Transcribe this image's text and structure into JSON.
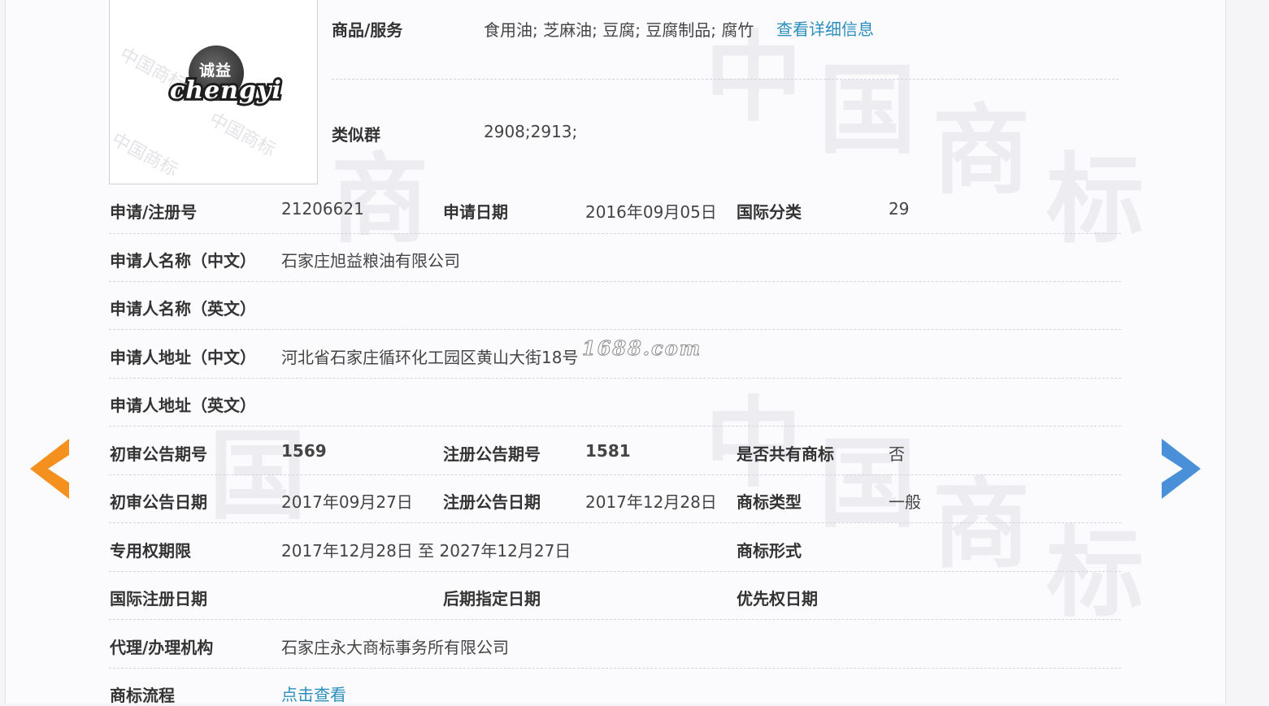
{
  "colors": {
    "label": "#333333",
    "value": "#444444",
    "link": "#2a8fbd",
    "prev_arrow": "#f4901e",
    "next_arrow": "#4a90d9"
  },
  "logo": {
    "brand_cn": "诚益",
    "brand_en": "chengyi",
    "watermark_text": "中国商标"
  },
  "background_watermark": [
    "中",
    "国",
    "商",
    "标"
  ],
  "site_watermark": "1688.com",
  "goods": {
    "label": "商品/服务",
    "value": "食用油; 芝麻油; 豆腐; 豆腐制品; 腐竹",
    "link": "查看详细信息"
  },
  "similar_group": {
    "label": "类似群",
    "value": "2908;2913;"
  },
  "fields": {
    "reg_no": {
      "label": "申请/注册号",
      "value": "21206621"
    },
    "apply_date": {
      "label": "申请日期",
      "value": "2016年09月05日"
    },
    "intl_class": {
      "label": "国际分类",
      "value": "29"
    },
    "applicant_cn": {
      "label": "申请人名称（中文）",
      "value": "石家庄旭益粮油有限公司"
    },
    "applicant_en": {
      "label": "申请人名称（英文）",
      "value": ""
    },
    "address_cn": {
      "label": "申请人地址（中文）",
      "value": "河北省石家庄循环化工园区黄山大街18号"
    },
    "address_en": {
      "label": "申请人地址（英文）",
      "value": ""
    },
    "prelim_issue": {
      "label": "初审公告期号",
      "value": "1569"
    },
    "reg_issue": {
      "label": "注册公告期号",
      "value": "1581"
    },
    "shared": {
      "label": "是否共有商标",
      "value": "否"
    },
    "prelim_date": {
      "label": "初审公告日期",
      "value": "2017年09月27日"
    },
    "reg_date": {
      "label": "注册公告日期",
      "value": "2017年12月28日"
    },
    "tm_type": {
      "label": "商标类型",
      "value": "一般"
    },
    "exclusive_period": {
      "label": "专用权期限",
      "value": "2017年12月28日 至 2027年12月27日"
    },
    "tm_form": {
      "label": "商标形式",
      "value": ""
    },
    "intl_reg_date": {
      "label": "国际注册日期",
      "value": ""
    },
    "later_designation": {
      "label": "后期指定日期",
      "value": ""
    },
    "priority_date": {
      "label": "优先权日期",
      "value": ""
    },
    "agent": {
      "label": "代理/办理机构",
      "value": "石家庄永大商标事务所有限公司"
    },
    "process": {
      "label": "商标流程",
      "link": "点击查看"
    }
  },
  "nav": {
    "prev_icon": "arrow-left-icon",
    "next_icon": "arrow-right-icon"
  }
}
